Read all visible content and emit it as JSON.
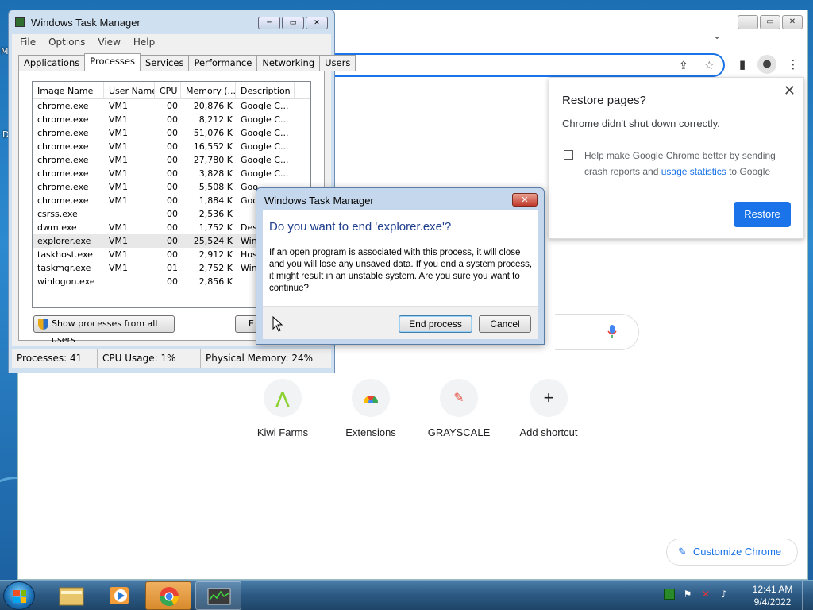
{
  "desktop": {
    "labels": [
      "M",
      "D"
    ]
  },
  "chrome": {
    "window_buttons": [
      "─",
      "▭",
      "✕"
    ],
    "restore_bubble": {
      "title": "Restore pages?",
      "subtitle": "Chrome didn't shut down correctly.",
      "checkbox_text_1": "Help make Google Chrome better by sending crash reports and ",
      "checkbox_link": "usage statistics",
      "checkbox_text_2": " to Google",
      "button": "Restore",
      "close": "✕"
    },
    "shortcuts": [
      {
        "label": "Kiwi Farms",
        "icon": "kiwi-icon"
      },
      {
        "label": "Extensions",
        "icon": "chrome-web-store-icon"
      },
      {
        "label": "GRAYSCALE",
        "icon": "grayscale-icon"
      },
      {
        "label": "Add shortcut",
        "icon": "plus-icon"
      }
    ],
    "customize": "Customize Chrome"
  },
  "task_manager": {
    "title": "Windows Task Manager",
    "window_buttons": [
      "─",
      "▭",
      "✕"
    ],
    "menu": [
      "File",
      "Options",
      "View",
      "Help"
    ],
    "tabs": [
      "Applications",
      "Processes",
      "Services",
      "Performance",
      "Networking",
      "Users"
    ],
    "active_tab": "Processes",
    "columns": [
      "Image Name",
      "User Name",
      "CPU",
      "Memory (...",
      "Description"
    ],
    "rows": [
      [
        "chrome.exe",
        "VM1",
        "00",
        "20,876 K",
        "Google C..."
      ],
      [
        "chrome.exe",
        "VM1",
        "00",
        "8,212 K",
        "Google C..."
      ],
      [
        "chrome.exe",
        "VM1",
        "00",
        "51,076 K",
        "Google C..."
      ],
      [
        "chrome.exe",
        "VM1",
        "00",
        "16,552 K",
        "Google C..."
      ],
      [
        "chrome.exe",
        "VM1",
        "00",
        "27,780 K",
        "Google C..."
      ],
      [
        "chrome.exe",
        "VM1",
        "00",
        "3,828 K",
        "Google C..."
      ],
      [
        "chrome.exe",
        "VM1",
        "00",
        "5,508 K",
        "Goo"
      ],
      [
        "chrome.exe",
        "VM1",
        "00",
        "1,884 K",
        "Goo"
      ],
      [
        "csrss.exe",
        "",
        "00",
        "2,536 K",
        ""
      ],
      [
        "dwm.exe",
        "VM1",
        "00",
        "1,752 K",
        "Des"
      ],
      [
        "explorer.exe",
        "VM1",
        "00",
        "25,524 K",
        "Win"
      ],
      [
        "taskhost.exe",
        "VM1",
        "00",
        "2,912 K",
        "Hos"
      ],
      [
        "taskmgr.exe",
        "VM1",
        "01",
        "2,752 K",
        "Win"
      ],
      [
        "winlogon.exe",
        "",
        "00",
        "2,856 K",
        ""
      ]
    ],
    "selected_row": 10,
    "show_all_button": "Show processes from all users",
    "end_button_partial": "E",
    "status": {
      "processes": "Processes: 41",
      "cpu": "CPU Usage: 1%",
      "memory": "Physical Memory: 24%"
    }
  },
  "dialog": {
    "title": "Windows Task Manager",
    "close": "✕",
    "question": "Do you want to end 'explorer.exe'?",
    "message": "If an open program is associated with this process, it will close and you will lose any unsaved data. If you end a system process, it might result in an unstable system. Are you sure you want to continue?",
    "end_button": "End process",
    "cancel_button": "Cancel"
  },
  "taskbar": {
    "items": [
      "windows-explorer-icon",
      "media-player-icon",
      "chrome-icon",
      "task-manager-icon"
    ],
    "active_item": "chrome-icon",
    "time": "12:41 AM",
    "date": "9/4/2022"
  }
}
